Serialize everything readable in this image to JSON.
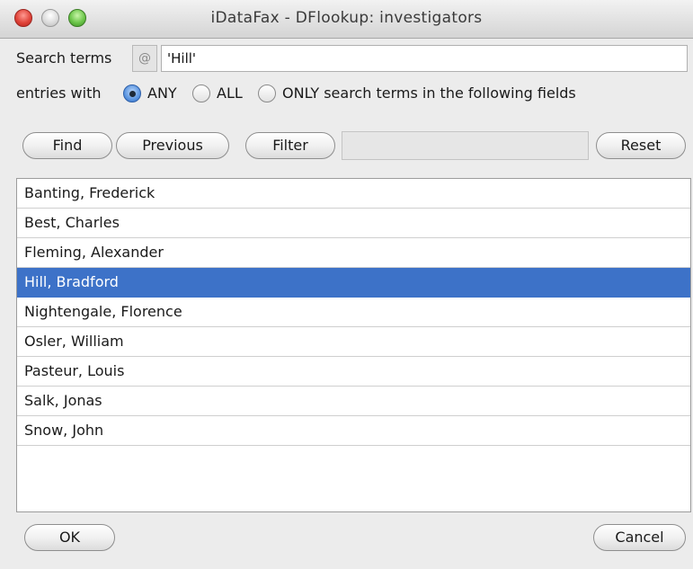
{
  "window": {
    "title": "iDataFax - DFlookup: investigators"
  },
  "search": {
    "label": "Search terms",
    "at_symbol": "@",
    "value": "'Hill'"
  },
  "match": {
    "prefix": "entries with",
    "options": [
      {
        "label": "ANY",
        "checked": true
      },
      {
        "label": "ALL",
        "checked": false
      },
      {
        "label": "ONLY search terms in the following fields",
        "checked": false
      }
    ]
  },
  "buttons": {
    "find": "Find",
    "previous": "Previous",
    "filter": "Filter",
    "reset": "Reset",
    "ok": "OK",
    "cancel": "Cancel"
  },
  "investigators": {
    "selected_index": 3,
    "items": [
      "Banting, Frederick",
      "Best, Charles",
      "Fleming, Alexander",
      "Hill, Bradford",
      "Nightengale, Florence",
      "Osler, William",
      "Pasteur, Louis",
      "Salk, Jonas",
      "Snow, John"
    ]
  },
  "colors": {
    "selection": "#3d72c8",
    "close_button": "#e0443a",
    "zoom_button": "#6cc64a"
  }
}
